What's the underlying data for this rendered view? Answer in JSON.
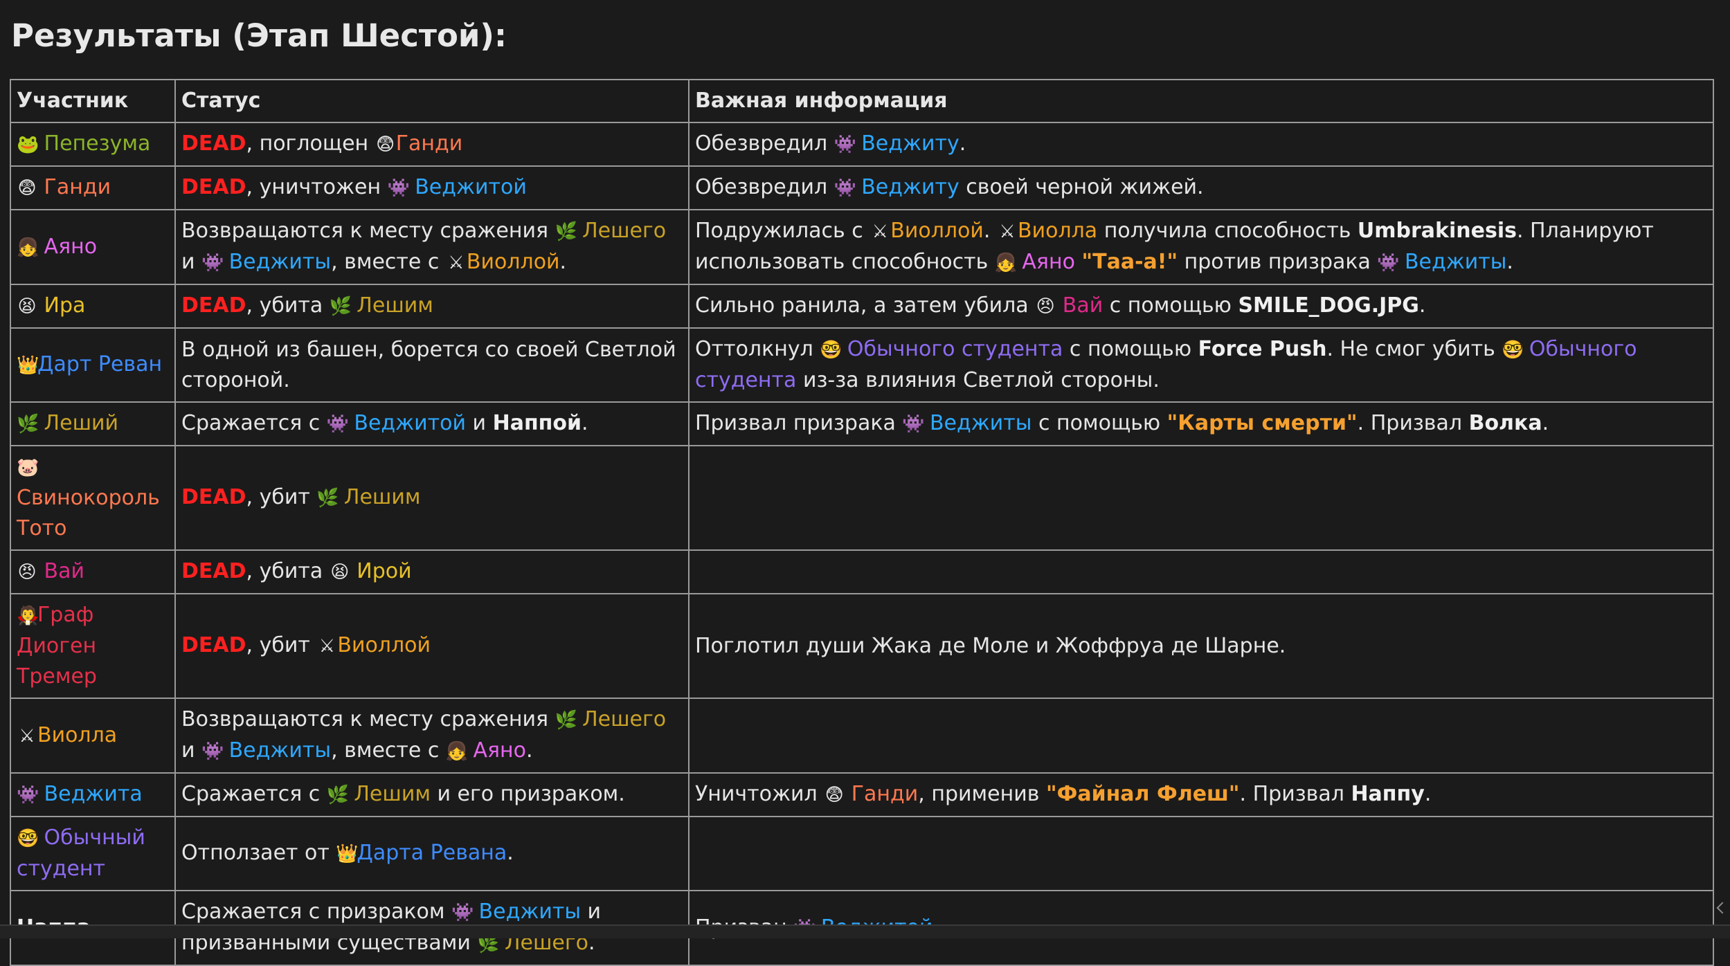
{
  "title": "Результаты (Этап Шестой):",
  "headers": {
    "participant": "Участник",
    "status": "Статус",
    "info": "Важная информация"
  },
  "icons": {
    "frog": "🐸",
    "fear": "😨",
    "girl": "👧",
    "tired": "😫",
    "crown": "👑",
    "herb": "🌿",
    "pig": "🐷",
    "angry": "😠",
    "vampire": "🧛",
    "swords": "⚔",
    "invader": "👾",
    "nerd": "🤓"
  },
  "words": {
    "dead": "DEAD",
    "pepezuma": "Пепезума",
    "gandi": "Ганди",
    "vedzhitu": "Веджиту",
    "vedzhitoy": "Веджитой",
    "vedzhity": "Веджиты",
    "ayano": "Аяно",
    "ira": "Ира",
    "iroy": "Ирой",
    "leshego": "Лешего",
    "leshim": "Лешим",
    "leshiy": "Леший",
    "violloy": "Виоллой",
    "violla": "Виолла",
    "vay": "Вай",
    "dart_revan": "Дарт Реван",
    "darta_revana": "Дарта Ревана",
    "student": "Обычного студента",
    "student_name": "Обычный студент",
    "svinokorol": "Свинокороль Тото",
    "graf": "Граф Диоген Тремер",
    "vedzhita": "Веджита",
    "nappa": "Наппа",
    "nappoy": "Наппой",
    "nappu": "Наппу",
    "umbra": "Umbrakinesis",
    "taa": "\"Таа-а!\"",
    "smile": "SMILE_DOG.JPG",
    "force": "Force Push",
    "karty": "\"Карты смерти\"",
    "volka": "Волка",
    "final": "\"Файнал Флеш\""
  },
  "text": {
    "r1_s": ", поглощен ",
    "r1_i": "Обезвредил ",
    "r2_s": ", уничтожен ",
    "r2_i1": "Обезвредил ",
    "r2_i2": " своей черной жижей.",
    "r3_s1": "Возвращаются к месту сражения ",
    "r3_s2": " и ",
    "r3_s3": ", вместе с ",
    "r3_i1": "Подружилась с ",
    "r3_i2": " получила способность ",
    "r3_i3": ". Планируют использовать способность ",
    "r3_i4": " против призрака ",
    "r4_s": ", убита ",
    "r4_i1": "Сильно ранила, а затем убила ",
    "r4_i2": " с помощью ",
    "r5_s": "В одной из башен, борется со своей Светлой стороной.",
    "r5_i1": "Оттолкнул ",
    "r5_i2": " с помощью ",
    "r5_i3": ". Не смог убить ",
    "r5_i4": " из-за влияния Светлой стороны.",
    "r6_s1": "Сражается с ",
    "r6_s2": " и ",
    "r6_i1": "Призвал призрака ",
    "r6_i2": " с помощью ",
    "r6_i3": ". Призвал ",
    "r7_s": ", убит ",
    "r8_s": ", убита ",
    "r9_s": ", убит ",
    "r9_i": "Поглотил души Жака де Моле и Жоффруа де Шарне.",
    "r10_s1": "Возвращаются к месту сражения ",
    "r10_s2": " и ",
    "r10_s3": ", вместе с ",
    "r11_s1": "Сражается с ",
    "r11_s2": " и его призраком.",
    "r11_i1": "Уничтожил ",
    "r11_i2": ", применив ",
    "r11_i3": ". Призвал ",
    "r12_s": "Отползает от ",
    "r13_s1": "Сражается с призраком ",
    "r13_s2": " и призванными существами ",
    "r13_i": "Призван ",
    "dot": ".",
    "space": " "
  }
}
